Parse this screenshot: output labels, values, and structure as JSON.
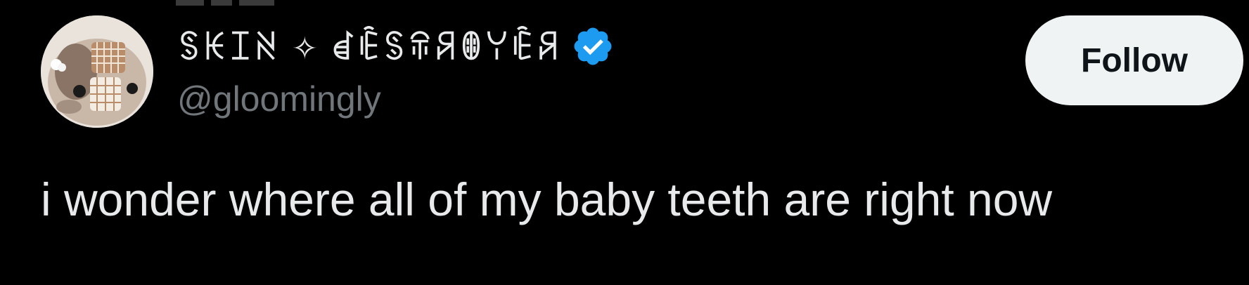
{
  "tweet": {
    "author": {
      "display_name": "ꌗꀘꀤꋊ ✧ ꀸꍟꌗꋖꋪꂦꌩꍟꋪ",
      "handle": "@gloomingly",
      "verified": true,
      "avatar_icon": "avatar-image"
    },
    "follow_label": "Follow",
    "text": "i wonder where all of my baby teeth are right now"
  },
  "colors": {
    "background": "#000000",
    "text_primary": "#e7e9ea",
    "text_secondary": "#71767b",
    "verified_badge": "#1d9bf0",
    "follow_bg": "#eff3f4",
    "follow_text": "#0f1419"
  }
}
